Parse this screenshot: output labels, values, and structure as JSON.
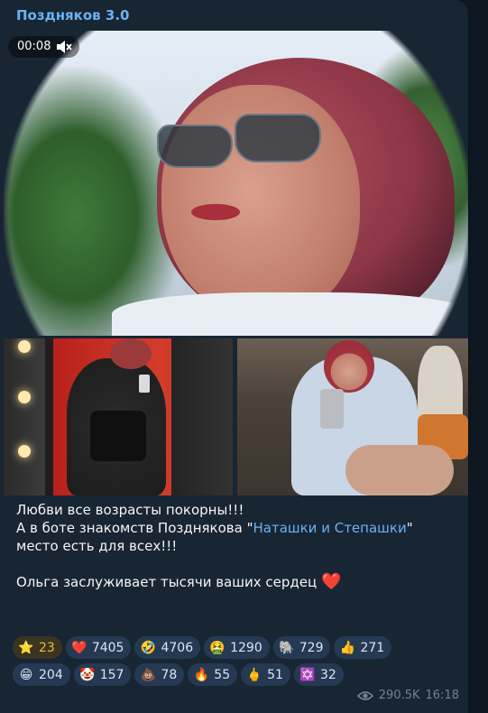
{
  "channel": {
    "name": "Поздняков 3.0"
  },
  "video": {
    "timer": "00:08"
  },
  "post": {
    "line1": "Любви все возрасты покорны!!!",
    "line2_before": "А в боте знакомств Позднякова \"",
    "line2_link": "Наташки и Степашки",
    "line2_after": "\" место есть для всех!!!",
    "line3": "Ольга заслуживает тысячи ваших сердец",
    "heart": "❤️"
  },
  "reactions": [
    {
      "emoji": "⭐",
      "count": "23",
      "paid": true
    },
    {
      "emoji": "❤️",
      "count": "7405"
    },
    {
      "emoji": "🤣",
      "count": "4706"
    },
    {
      "emoji": "🤮",
      "count": "1290"
    },
    {
      "emoji": "🐘",
      "count": "729"
    },
    {
      "emoji": "👍",
      "count": "271"
    },
    {
      "emoji": "😁",
      "count": "204"
    },
    {
      "emoji": "🤡",
      "count": "157"
    },
    {
      "emoji": "💩",
      "count": "78"
    },
    {
      "emoji": "🔥",
      "count": "55"
    },
    {
      "emoji": "🖕",
      "count": "51"
    },
    {
      "emoji": "✡️",
      "count": "32"
    }
  ],
  "meta": {
    "views": "290.5K",
    "time": "16:18"
  }
}
